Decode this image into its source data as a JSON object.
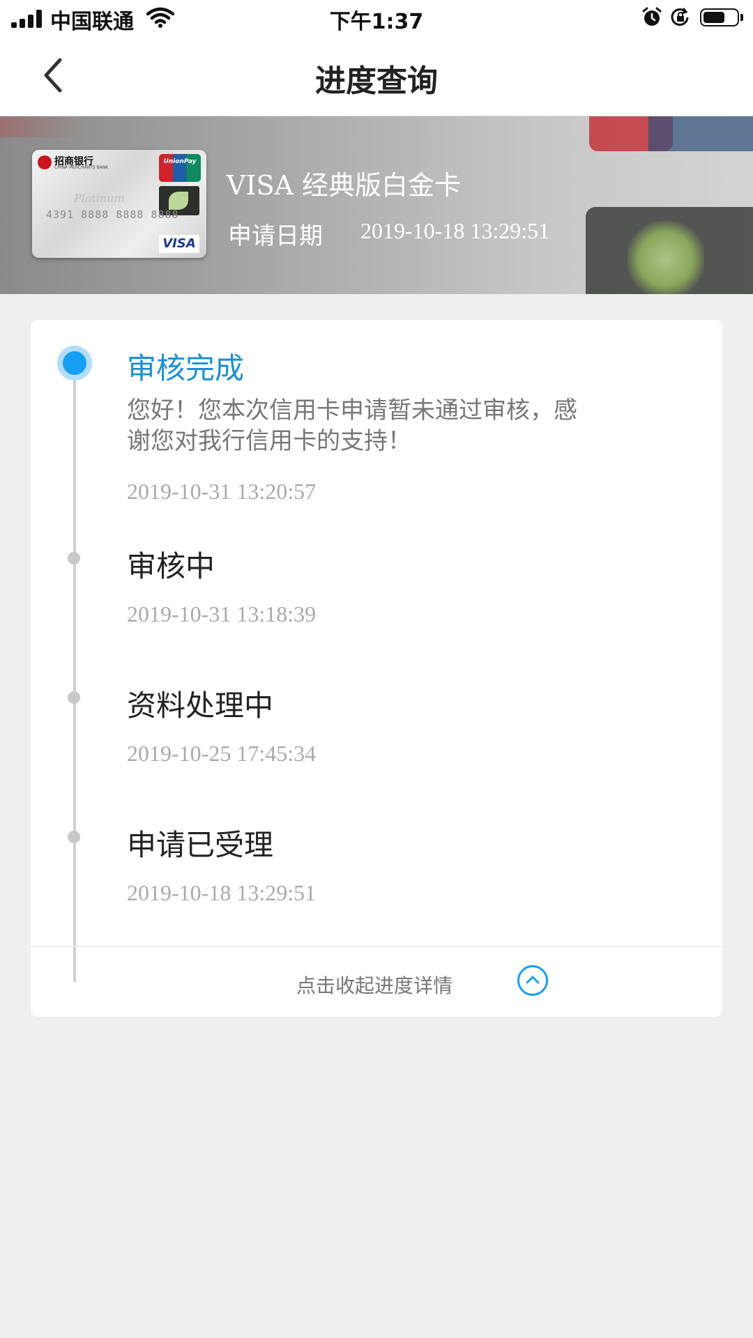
{
  "status_bar": {
    "carrier": "中国联通",
    "time": "下午1:37"
  },
  "nav": {
    "title": "进度查询"
  },
  "card": {
    "name": "VISA 经典版白金卡",
    "apply_label": "申请日期",
    "apply_date": "2019-10-18 13:29:51",
    "image": {
      "bank_name": "招商银行",
      "bank_name_en": "CHINA MERCHANTS BANK",
      "unionpay": "UnionPay",
      "card_number": "4391 8888 8888 8888",
      "tier": "Platinum",
      "network": "VISA"
    }
  },
  "progress": {
    "steps": [
      {
        "title": "审核完成",
        "desc": "您好！您本次信用卡申请暂未通过审核，感谢您对我行信用卡的支持！",
        "time": "2019-10-31 13:20:57",
        "active": true
      },
      {
        "title": "审核中",
        "time": "2019-10-31 13:18:39"
      },
      {
        "title": "资料处理中",
        "time": "2019-10-25 17:45:34"
      },
      {
        "title": "申请已受理",
        "time": "2019-10-18 13:29:51"
      }
    ],
    "collapse_label": "点击收起进度详情"
  },
  "colors": {
    "accent": "#169ff4",
    "active_title": "#1c8fd4",
    "page_bg": "#efefef"
  },
  "icons": {
    "back": "chevron-left-icon",
    "collapse": "chevron-up-circle-icon"
  }
}
